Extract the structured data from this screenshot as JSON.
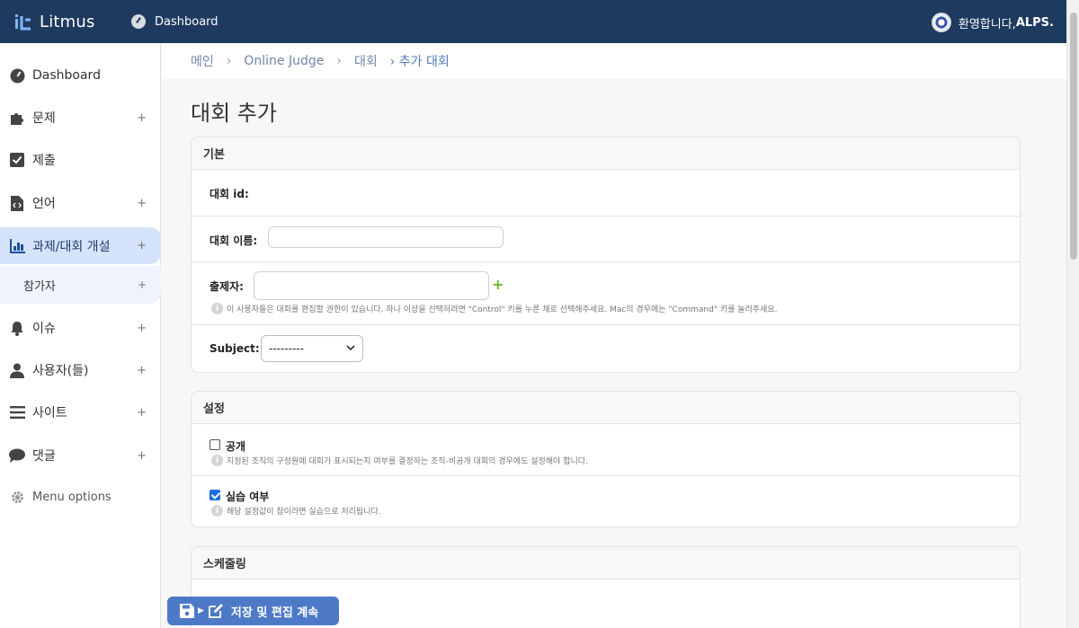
{
  "topbar": {
    "brand": "Litmus",
    "nav_label": "Dashboard",
    "welcome_prefix": "환영합니다, ",
    "username": "ALPS."
  },
  "sidebar": {
    "items": [
      {
        "label": "Dashboard",
        "icon": "dashboard-icon",
        "plus": ""
      },
      {
        "label": "문제",
        "icon": "puzzle-icon",
        "plus": "+"
      },
      {
        "label": "제출",
        "icon": "check-square-icon",
        "plus": ""
      },
      {
        "label": "언어",
        "icon": "code-file-icon",
        "plus": "+"
      },
      {
        "label": "과제/대회 개설",
        "icon": "chart-icon",
        "plus": "+"
      },
      {
        "label": "이슈",
        "icon": "bell-icon",
        "plus": "+"
      },
      {
        "label": "사용자(들)",
        "icon": "user-icon",
        "plus": "+"
      },
      {
        "label": "사이트",
        "icon": "list-icon",
        "plus": "+"
      },
      {
        "label": "댓글",
        "icon": "comment-icon",
        "plus": "+"
      }
    ],
    "sub_item": {
      "label": "참가자",
      "plus": "+"
    },
    "menu_options": "Menu options"
  },
  "breadcrumb": {
    "items": [
      "메인",
      "Online Judge",
      "대회"
    ],
    "separator": "›",
    "current": "› 추가 대회"
  },
  "page_title": "대회 추가",
  "basic": {
    "title": "기본",
    "contest_id_label": "대회 id:",
    "contest_name_label": "대회 이름:",
    "contest_name_value": "",
    "author_label": "출제자:",
    "author_value": "",
    "author_help": "이 사용자들은 대회를 편집할 권한이 있습니다. 하나 이상을 선택하려면 \"Control\" 키를 누른 채로 선택해주세요. Mac의 경우에는 \"Command\" 키를 눌러주세요.",
    "subject_label": "Subject:",
    "subject_value": "---------"
  },
  "settings": {
    "title": "설정",
    "public_label": "공개",
    "public_checked": false,
    "public_help": "지정된 조직의 구성원에 대회가 표시되는지 여부를 결정하는 조직-비공개 대회의 경우에도 설정해야 합니다.",
    "practice_label": "실습 여부",
    "practice_checked": true,
    "practice_help": "해당 설정값이 참이라면 실습으로 처리됩니다."
  },
  "scheduling": {
    "title": "스케줄링"
  },
  "save_button": {
    "label": "저장 및 편집 계속"
  },
  "colors": {
    "topbar": "#1f3a5f",
    "active_menu": "#d6e4fb",
    "save_button": "#4d79c7",
    "add_green": "#6bb32e"
  }
}
